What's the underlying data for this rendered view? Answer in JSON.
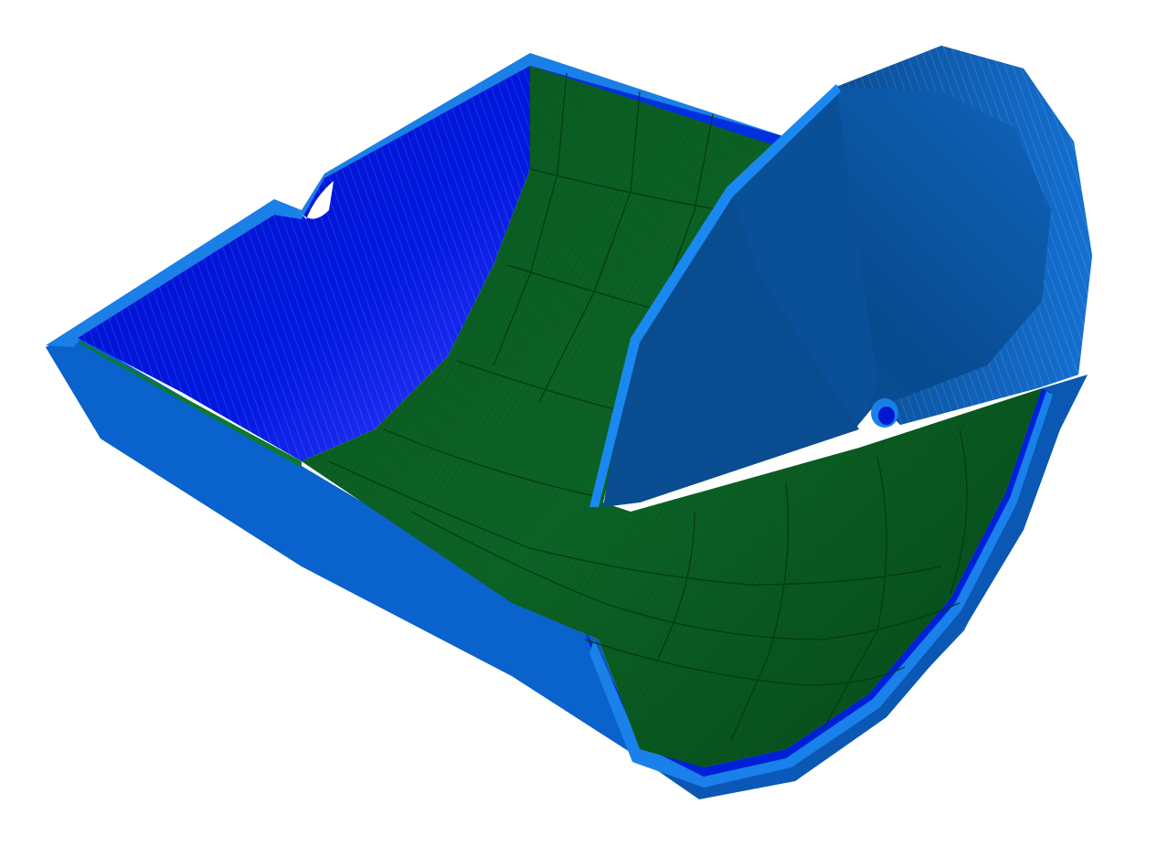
{
  "scene": {
    "subject": "3d-rendered-cutaway-trough-model",
    "background_color": "#ffffff",
    "colors": {
      "outer_shell": "#0a6ad8",
      "outer_shell_dark": "#0550a8",
      "shell_rim": "#1a7fe6",
      "inner_wall": "#0011d6",
      "inner_wall_light": "#3a3aff",
      "floor_green": "#0c5e24",
      "floor_green_dark": "#064a1a",
      "cone": "#0a5aaa",
      "cone_dark": "#0a4a8c",
      "cone_light": "#1a78d8"
    }
  }
}
